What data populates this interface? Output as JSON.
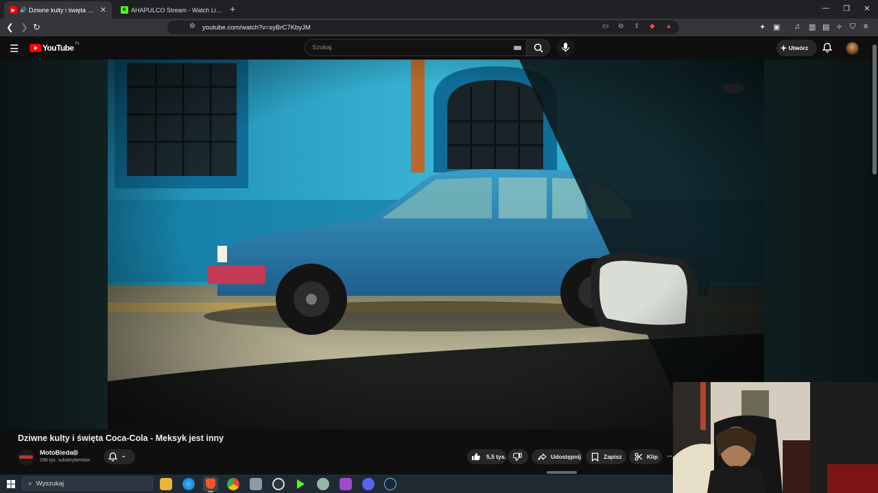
{
  "browser": {
    "tabs": [
      {
        "title": "Dziwne kulty i święta Coca-Co",
        "active": true,
        "favicon": "youtube-icon"
      },
      {
        "title": "AHAPULCO Stream - Watch Live on K",
        "active": false,
        "favicon": "kick-icon"
      }
    ],
    "new_tab_label": "+",
    "url": "youtube.com/watch?v=syBrC7KbyJM"
  },
  "youtube": {
    "logo_text": "YouTube",
    "country_code": "PL",
    "search_placeholder": "Szukaj",
    "create_label": "Utwórz"
  },
  "video": {
    "title": "Dziwne kulty i święta Coca-Cola - Meksyk jest inny",
    "channel_name": "MotoBieda",
    "subscribers": "298 tys. subskrybentów",
    "likes": "5,5 tys.",
    "share_label": "Udostępnij",
    "save_label": "Zapisz",
    "clip_label": "Klip"
  },
  "taskbar": {
    "search_placeholder": "Wyszukaj"
  },
  "colors": {
    "youtube_red": "#ff0000",
    "page_bg": "#0f0f0f",
    "chip_bg": "#272727",
    "browser_tab_bg": "#35363a"
  }
}
